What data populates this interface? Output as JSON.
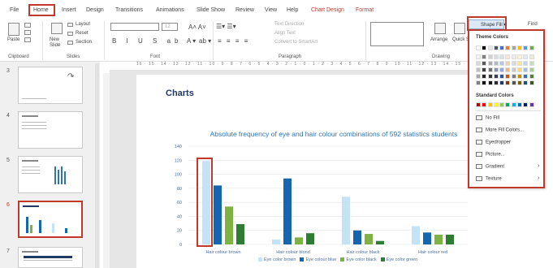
{
  "tabs": {
    "file": "File",
    "home": "Home",
    "insert": "Insert",
    "design": "Design",
    "transitions": "Transitions",
    "animations": "Animations",
    "slideshow": "Slide Show",
    "review": "Review",
    "view": "View",
    "help": "Help",
    "chart_design": "Chart Design",
    "format": "Format"
  },
  "ribbon": {
    "paste": "Paste",
    "clipboard": "Clipboard",
    "new_slide": "New Slide",
    "layout": "Layout",
    "reset": "Reset",
    "section": "Section",
    "slides": "Slides",
    "font_size": "12",
    "font": "Font",
    "text_direction": "Text Direction",
    "align_text": "Align Text",
    "convert_smartart": "Convert to SmartArt",
    "paragraph": "Paragraph",
    "arrange": "Arrange",
    "quick_styles": "Quick Styles",
    "drawing": "Drawing",
    "shape_fill": "Shape Fill",
    "find": "Find"
  },
  "ruler": "16 · 15 · 14 · 13 · 12 · 11 · 10 · 9 · 8 · 7 · 6 · 5 · 4 · 3 · 2 · 1 · 0 · 1 · 2 · 3 · 4 · 5 · 6 · 7 · 8 · 9 · 10 · 11 · 12 · 13 · 14 · 15 · 16",
  "slides": {
    "numbers": [
      "3",
      "4",
      "5",
      "6",
      "7"
    ]
  },
  "slide": {
    "title": "Charts"
  },
  "chart_data": {
    "type": "bar",
    "title": "Absolute frequency of eye and hair colour combinations of 592 statistics students",
    "categories": [
      "Hair colour brown",
      "Hair colour blond",
      "Hair colour black",
      "Hair colour red"
    ],
    "ylim": [
      0,
      140
    ],
    "yticks": [
      0,
      20,
      40,
      60,
      80,
      100,
      120,
      140
    ],
    "series": [
      {
        "name": "Eye color brown",
        "color": "#c5e3f6",
        "values": [
          119,
          7,
          68,
          26
        ]
      },
      {
        "name": "Eye colour blue",
        "color": "#1565b0",
        "values": [
          84,
          94,
          20,
          17
        ]
      },
      {
        "name": "Eye color black",
        "color": "#7cb342",
        "values": [
          54,
          10,
          15,
          14
        ]
      },
      {
        "name": "Eye color green",
        "color": "#2e7d32",
        "values": [
          29,
          16,
          5,
          14
        ]
      }
    ],
    "legend": "bottom",
    "grid": true
  },
  "dropdown": {
    "theme_colors": "Theme Colors",
    "standard_colors": "Standard Colors",
    "no_fill": "No Fill",
    "more_colors": "More Fill Colors...",
    "eyedropper": "Eyedropper",
    "picture": "Picture...",
    "gradient": "Gradient",
    "texture": "Texture",
    "theme_rows": [
      [
        "#ffffff",
        "#000000",
        "#e7e6e6",
        "#44546a",
        "#4472c4",
        "#ed7d31",
        "#a5a5a5",
        "#ffc000",
        "#5b9bd5",
        "#70ad47"
      ],
      [
        "#f2f2f2",
        "#7f7f7f",
        "#d0cece",
        "#d6dce4",
        "#d9e2f3",
        "#fbe5d5",
        "#ededed",
        "#fff2cc",
        "#deebf6",
        "#e2efd9"
      ],
      [
        "#d8d8d8",
        "#595959",
        "#aeabab",
        "#adb9ca",
        "#b4c6e7",
        "#f7cbac",
        "#dbdbdb",
        "#fee599",
        "#bdd7ee",
        "#c5e0b3"
      ],
      [
        "#bfbfbf",
        "#3f3f3f",
        "#757070",
        "#8496b0",
        "#8eaadb",
        "#f4b183",
        "#c9c9c9",
        "#ffd965",
        "#9cc3e5",
        "#a8d08d"
      ],
      [
        "#a5a5a5",
        "#262626",
        "#3a3838",
        "#323f4f",
        "#2f5496",
        "#c55a11",
        "#7b7b7b",
        "#bf9000",
        "#2e75b5",
        "#538135"
      ],
      [
        "#7f7f7f",
        "#0c0c0c",
        "#171616",
        "#222a35",
        "#1f3864",
        "#833c0b",
        "#525252",
        "#7f6000",
        "#1e4e79",
        "#375623"
      ]
    ],
    "standard": [
      "#c00000",
      "#ff0000",
      "#ffc000",
      "#ffff00",
      "#92d050",
      "#00b050",
      "#00b0f0",
      "#0070c0",
      "#002060",
      "#7030a0"
    ]
  }
}
